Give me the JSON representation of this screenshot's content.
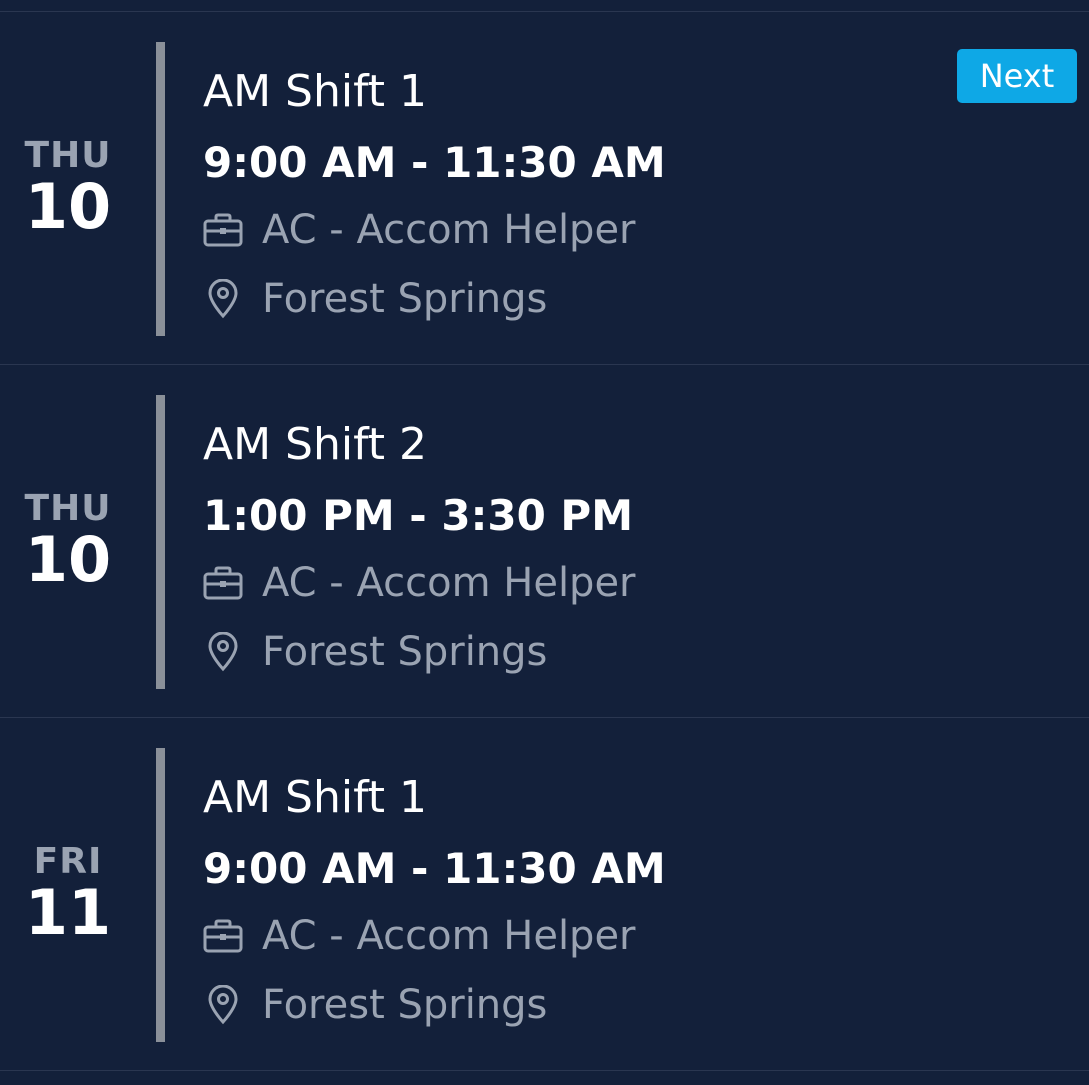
{
  "shifts": [
    {
      "day_of_week": "THU",
      "day_number": "10",
      "title": "AM Shift 1",
      "time": "9:00 AM - 11:30 AM",
      "role": "AC - Accom Helper",
      "location": "Forest Springs",
      "badge": "Next"
    },
    {
      "day_of_week": "THU",
      "day_number": "10",
      "title": "AM Shift 2",
      "time": "1:00 PM - 3:30 PM",
      "role": "AC - Accom Helper",
      "location": "Forest Springs"
    },
    {
      "day_of_week": "FRI",
      "day_number": "11",
      "title": "AM Shift 1",
      "time": "9:00 AM - 11:30 AM",
      "role": "AC - Accom Helper",
      "location": "Forest Springs"
    }
  ],
  "icons": {
    "role": "briefcase-icon",
    "location": "map-pin-icon"
  },
  "colors": {
    "background": "#13203a",
    "divider": "#2a3650",
    "accent_bar": "#8a9099",
    "muted_text": "#9aa3b2",
    "badge": "#0ea8e6"
  }
}
